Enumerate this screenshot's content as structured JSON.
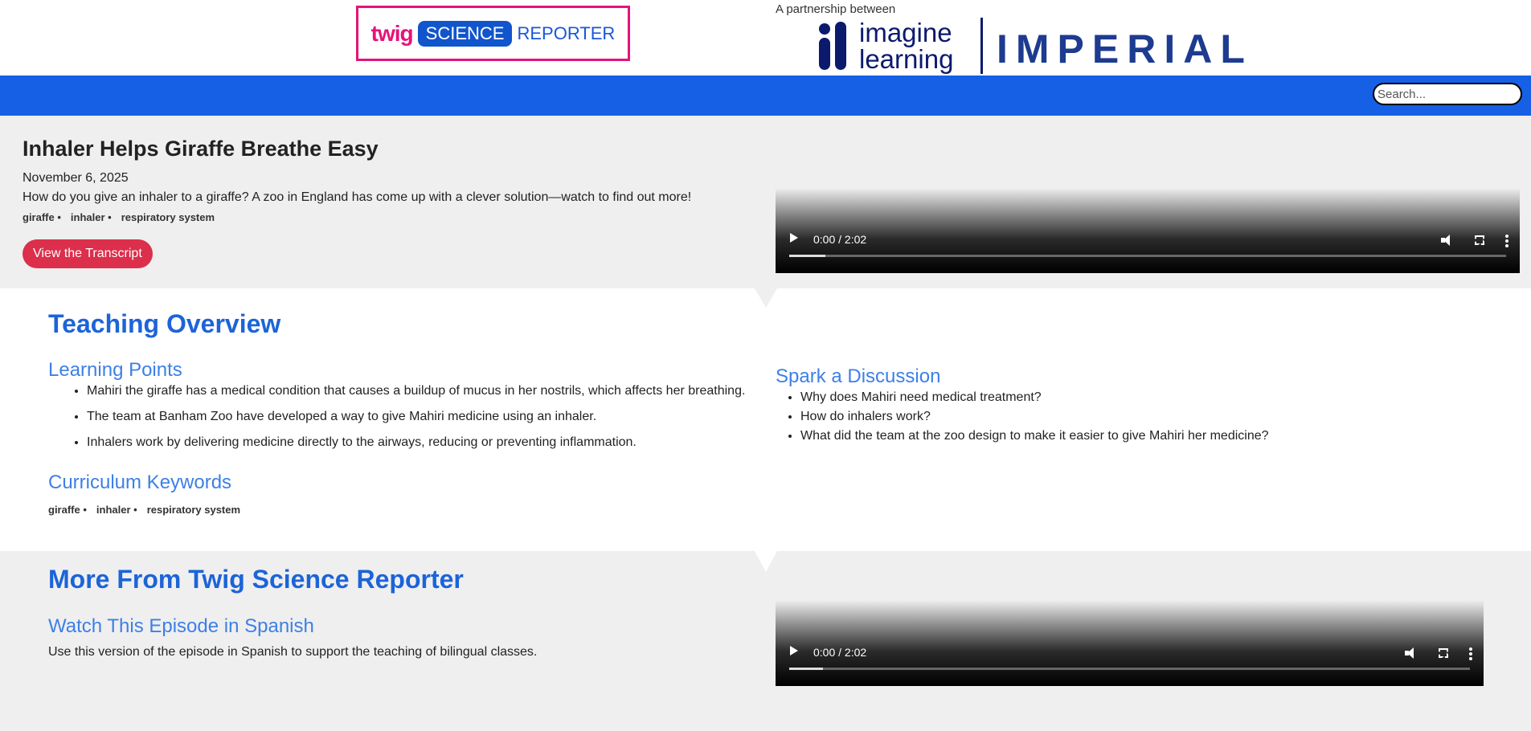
{
  "header": {
    "logo_twig": "twig",
    "logo_science": "SCIENCE",
    "logo_reporter": "REPORTER",
    "partnership_text": "A partnership between",
    "partner1_line1": "imagine",
    "partner1_line2": "learning",
    "partner2": "IMPERIAL"
  },
  "nav": {
    "search_placeholder": "Search..."
  },
  "hero": {
    "title": "Inhaler Helps Giraffe Breathe Easy",
    "date": "November 6, 2025",
    "description": "How do you give an inhaler to a giraffe? A zoo in England has come up with a clever solution—watch to find out more!",
    "tags": [
      "giraffe",
      "inhaler",
      "respiratory system"
    ],
    "transcript_button": "View the Transcript",
    "video": {
      "time": "0:00 / 2:02"
    }
  },
  "overview": {
    "title": "Teaching Overview",
    "learning_points_title": "Learning Points",
    "learning_points": [
      "Mahiri the giraffe has a medical condition that causes a buildup of mucus in her nostrils, which affects her breathing.",
      "The team at Banham Zoo have developed a way to give Mahiri medicine using an inhaler.",
      "Inhalers work by delivering medicine directly to the airways, reducing or preventing inflammation."
    ],
    "keywords_title": "Curriculum Keywords",
    "keywords": [
      "giraffe",
      "inhaler",
      "respiratory system"
    ],
    "discussion_title": "Spark a Discussion",
    "discussion": [
      "Why does Mahiri need medical treatment?",
      "How do inhalers work?",
      "What did the team at the zoo design to make it easier to give Mahiri her medicine?"
    ]
  },
  "more": {
    "title": "More From Twig Science Reporter",
    "spanish_title": "Watch This Episode in Spanish",
    "spanish_desc": "Use this version of the episode in Spanish to support the teaching of bilingual classes.",
    "video": {
      "time": "0:00 / 2:02"
    }
  },
  "colors": {
    "nav_blue": "#1560e4",
    "heading_blue": "#1c64d8",
    "button_red": "#dc2f4c",
    "logo_pink": "#e5137a",
    "section_grey": "#efefef"
  }
}
